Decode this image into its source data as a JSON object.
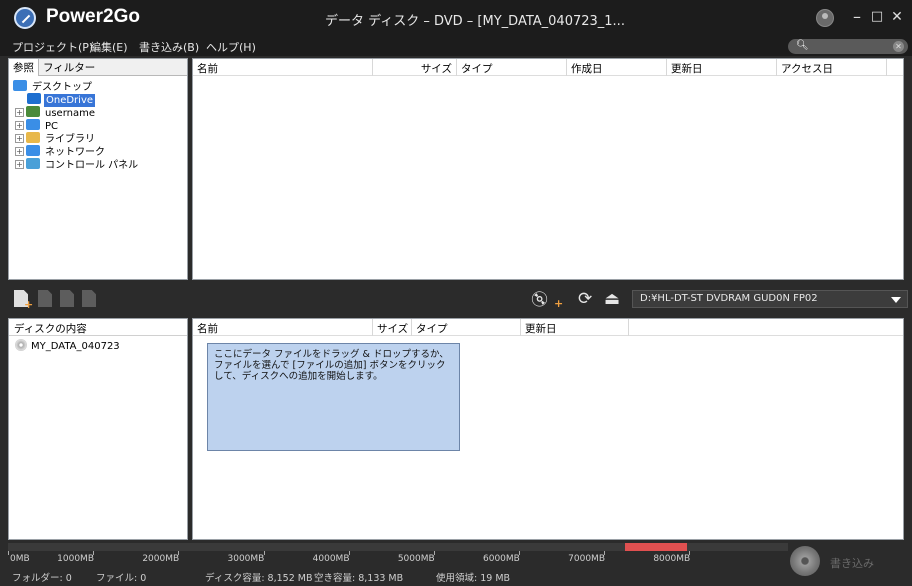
{
  "app": {
    "name": "Power2Go",
    "window_title": "データ ディスク – DVD – [MY_DATA_040723_1..."
  },
  "window_controls": {
    "minimize": "–",
    "maximize": "□",
    "close": "✕"
  },
  "menu": [
    {
      "label": "プロジェクト(P)"
    },
    {
      "label": "編集(E)"
    },
    {
      "label": "書き込み(B)"
    },
    {
      "label": "ヘルプ(H)"
    }
  ],
  "search": {
    "placeholder": "",
    "icon": "search-icon"
  },
  "tabs": [
    {
      "label": "参照",
      "active": true
    },
    {
      "label": "フィルター",
      "active": false
    }
  ],
  "tree": [
    {
      "label": "デスクトップ",
      "icon": "desktop-icon",
      "color": "#3a8ee6",
      "level": 0,
      "expander": false,
      "selected": false
    },
    {
      "label": "OneDrive",
      "icon": "cloud-icon",
      "color": "#1e6fd0",
      "level": 1,
      "expander": false,
      "selected": true
    },
    {
      "label": "username",
      "icon": "user-icon",
      "color": "#4a8a3a",
      "level": 1,
      "expander": true,
      "selected": false
    },
    {
      "label": "PC",
      "icon": "pc-icon",
      "color": "#3a8ee6",
      "level": 1,
      "expander": true,
      "selected": false
    },
    {
      "label": "ライブラリ",
      "icon": "library-icon",
      "color": "#e8b84a",
      "level": 1,
      "expander": true,
      "selected": false
    },
    {
      "label": "ネットワーク",
      "icon": "network-icon",
      "color": "#3a8ee6",
      "level": 1,
      "expander": true,
      "selected": false
    },
    {
      "label": "コントロール パネル",
      "icon": "control-panel-icon",
      "color": "#4aa0d8",
      "level": 1,
      "expander": true,
      "selected": false
    }
  ],
  "browser_columns": [
    "名前",
    "サイズ",
    "タイプ",
    "作成日",
    "更新日",
    "アクセス日"
  ],
  "drive": {
    "label": "D:¥HL-DT-ST DVDRAM GUD0N FP02"
  },
  "disc_panel": {
    "header": "ディスクの内容",
    "disc_name": "MY_DATA_040723"
  },
  "disc_columns": [
    "名前",
    "サイズ",
    "タイプ",
    "更新日"
  ],
  "hint": "ここにデータ ファイルをドラッグ & ドロップするか、ファイルを選んで [ファイルの追加] ボタンをクリックして、ディスクへの追加を開始します。",
  "capacity": {
    "used_fraction": 0.0,
    "overflow_start_mb": 8000,
    "max_mb": 9000,
    "ticks": [
      "0MB",
      "1000MB",
      "2000MB",
      "3000MB",
      "4000MB",
      "5000MB",
      "6000MB",
      "7000MB",
      "8000MB"
    ]
  },
  "burn": {
    "label": "書き込み"
  },
  "status": {
    "folders": "フォルダー:  0",
    "files": "ファイル:  0",
    "disc_capacity": "ディスク容量:  8,152 MB",
    "free_space": "空き容量:  8,133 MB",
    "used_space": "使用領域:  19 MB"
  }
}
